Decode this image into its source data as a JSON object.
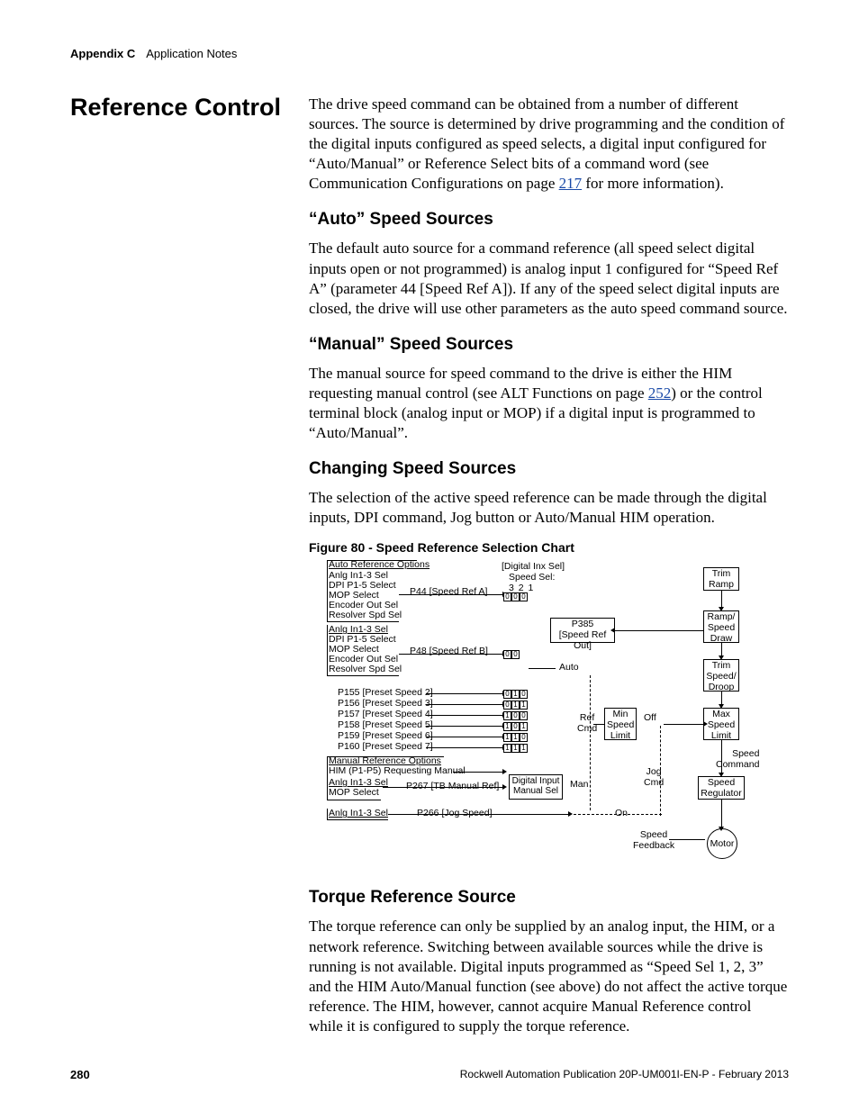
{
  "header": {
    "appendix": "Appendix C",
    "title": "Application Notes"
  },
  "section_title": "Reference Control",
  "intro": {
    "a": "The drive speed command can be obtained from a number of different sources. The source is determined by drive programming and the condition of the digital inputs configured as speed selects, a digital input configured for “Auto/Manual” or Reference Select bits of a command word (see Communication Configurations on page ",
    "link": "217",
    "b": " for more information)."
  },
  "auto": {
    "h": "“Auto” Speed Sources",
    "p": "The default auto source for a command reference (all speed select digital inputs open or not programmed) is analog input 1 configured for “Speed Ref A” (parameter 44 [Speed Ref A]). If any of the speed select digital inputs are closed, the drive will use other parameters as the auto speed command source."
  },
  "manual": {
    "h": "“Manual” Speed Sources",
    "a": "The manual source for speed command to the drive is either the HIM requesting manual control (see ALT Functions on page ",
    "link": "252",
    "b": ") or the control terminal block (analog input or MOP) if a digital input is programmed to “Auto/Manual”."
  },
  "changing": {
    "h": "Changing Speed Sources",
    "p": "The selection of the active speed reference can be made through the digital inputs, DPI command, Jog button or Auto/Manual HIM operation."
  },
  "figure": {
    "caption": "Figure 80 - Speed Reference Selection Chart"
  },
  "chart": {
    "auto_opts_title": "Auto Reference Options",
    "auto_opts": [
      "Anlg In1-3 Sel",
      "DPI P1-5 Select",
      "MOP Select",
      "Encoder Out Sel",
      "Resolver Spd Sel"
    ],
    "p44": "P44 [Speed Ref A]",
    "p48": "P48 [Speed Ref B]",
    "presets": [
      "P155 [Preset Speed 2]",
      "P156 [Preset Speed 3]",
      "P157 [Preset Speed 4]",
      "P158 [Preset Speed 5]",
      "P159 [Preset Speed 6]",
      "P160 [Preset Speed 7]"
    ],
    "man_title": "Manual Reference Options",
    "man_him": "HIM (P1-P5) Requesting Manual",
    "man_opts": [
      "Anlg In1-3 Sel",
      "MOP Select"
    ],
    "p267": "P267 [TB Manual Ref]",
    "jog_opts": "Anlg In1-3 Sel",
    "p266": "P266 [Jog Speed]",
    "digital_inx": "[Digital Inx Sel]",
    "speed_sel": "Speed Sel:",
    "bits_321": "3 2 1",
    "p385": "P385\n[Speed Ref Out]",
    "auto_lbl": "Auto",
    "ref_cmd": "Ref\nCmd",
    "min_speed": "Min\nSpeed\nLimit",
    "off_lbl": "Off",
    "jog_cmd": "Jog\nCmd",
    "on_lbl": "On",
    "man_lbl": "Man",
    "dig_man": "Digital Input\nManual Sel",
    "trim_ramp": "Trim\nRamp",
    "ramp_draw": "Ramp/\nSpeed\nDraw",
    "trim_droop": "Trim\nSpeed/\nDroop",
    "max_speed": "Max\nSpeed\nLimit",
    "speed_cmd": "Speed\nCommand",
    "speed_reg": "Speed\nRegulator",
    "speed_fb": "Speed\nFeedback",
    "motor": "Motor"
  },
  "torque": {
    "h": "Torque Reference Source",
    "p": "The torque reference can only be supplied by an analog input, the HIM, or a network reference. Switching between available sources while the drive is running is not available. Digital inputs programmed as “Speed Sel 1, 2, 3” and the HIM Auto/Manual function (see above) do not affect the active torque reference. The HIM, however, cannot acquire Manual Reference control while it is configured to supply the torque reference."
  },
  "footer": {
    "page": "280",
    "pub": "Rockwell Automation Publication 20P-UM001I-EN-P - February 2013"
  }
}
